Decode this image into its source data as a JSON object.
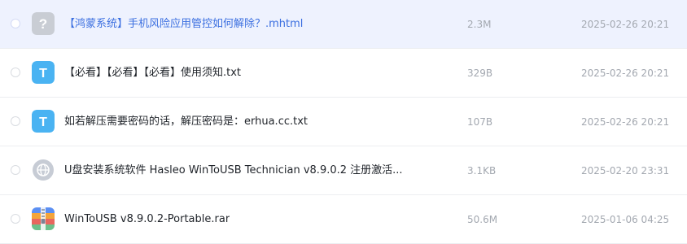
{
  "colors": {
    "selected_row_bg": "#eef2fe",
    "selected_name": "#3b6fe0",
    "name": "#1f2329",
    "meta": "#a3a8b0",
    "txt_icon": "#4ab3f2",
    "unknown_icon": "#c9cdd4",
    "web_icon": "#c7ccd5"
  },
  "files": [
    {
      "name": "【鸿蒙系统】手机风险应用管控如何解除？.mhtml",
      "size": "2.3M",
      "date": "2025-02-26 20:21",
      "icon": "unknown-file-icon",
      "selected": true
    },
    {
      "name": "【必看】【必看】【必看】使用须知.txt",
      "size": "329B",
      "date": "2025-02-26 20:21",
      "icon": "txt-file-icon",
      "selected": false
    },
    {
      "name": "如若解压需要密码的话，解压密码是：erhua.cc.txt",
      "size": "107B",
      "date": "2025-02-26 20:21",
      "icon": "txt-file-icon",
      "selected": false
    },
    {
      "name": "U盘安装系统软件 Hasleo WinToUSB Technician v8.9.0.2 注册激活...",
      "size": "3.1KB",
      "date": "2025-02-20 23:31",
      "icon": "web-link-icon",
      "selected": false
    },
    {
      "name": "WinToUSB v8.9.0.2-Portable.rar",
      "size": "50.6M",
      "date": "2025-01-06 04:25",
      "icon": "archive-file-icon",
      "selected": false
    }
  ]
}
